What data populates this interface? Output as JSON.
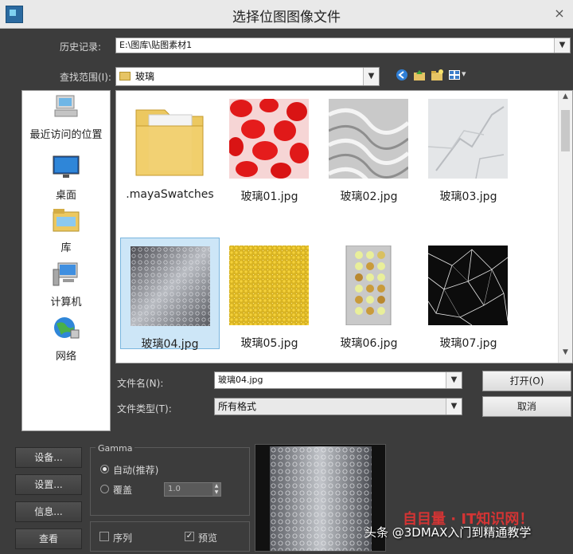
{
  "window": {
    "title": "选择位图图像文件",
    "close_glyph": "×"
  },
  "history": {
    "label": "历史记录:",
    "value": "E:\\图库\\贴图素材1",
    "arrow": "▼"
  },
  "lookin": {
    "label": "查找范围(I):",
    "value": "玻璃",
    "arrow": "▼",
    "view_menu_arrow": "▾"
  },
  "places": [
    {
      "label": "最近访问的位置",
      "icon": "recent-places-icon"
    },
    {
      "label": "桌面",
      "icon": "desktop-icon"
    },
    {
      "label": "库",
      "icon": "libraries-icon"
    },
    {
      "label": "计算机",
      "icon": "computer-icon"
    },
    {
      "label": "网络",
      "icon": "network-icon"
    }
  ],
  "files": [
    {
      "name": ".mayaSwatches",
      "type": "folder"
    },
    {
      "name": "玻璃01.jpg",
      "type": "image"
    },
    {
      "name": "玻璃02.jpg",
      "type": "image"
    },
    {
      "name": "玻璃03.jpg",
      "type": "image"
    },
    {
      "name": "玻璃04.jpg",
      "type": "image",
      "selected": true
    },
    {
      "name": "玻璃05.jpg",
      "type": "image"
    },
    {
      "name": "玻璃06.jpg",
      "type": "image"
    },
    {
      "name": "玻璃07.jpg",
      "type": "image"
    }
  ],
  "filename": {
    "label": "文件名(N):",
    "value": "玻璃04.jpg",
    "arrow": "▼"
  },
  "filetype": {
    "label": "文件类型(T):",
    "value": "所有格式",
    "arrow": "▼"
  },
  "buttons": {
    "open": "打开(O)",
    "cancel": "取消"
  },
  "left_buttons": [
    "设备...",
    "设置...",
    "信息...",
    "查看"
  ],
  "gamma": {
    "group_label": "Gamma",
    "auto_label": "自动(推荐)",
    "override_label": "覆盖",
    "override_value": "1.0",
    "spin_up": "▲",
    "spin_down": "▼"
  },
  "sequence": {
    "label": "序列",
    "checked": false
  },
  "preview_check": {
    "label": "预览",
    "checked": true,
    "check_glyph": "✓"
  },
  "scroll": {
    "up": "▲",
    "down": "▼"
  },
  "watermark": {
    "text": "头条 @3DMAX入门到精通教学",
    "red_text": "自目量 · IT知识网！"
  },
  "colors": {
    "selection": "#cde6f7",
    "dialog_bg": "#3c3c3c"
  }
}
